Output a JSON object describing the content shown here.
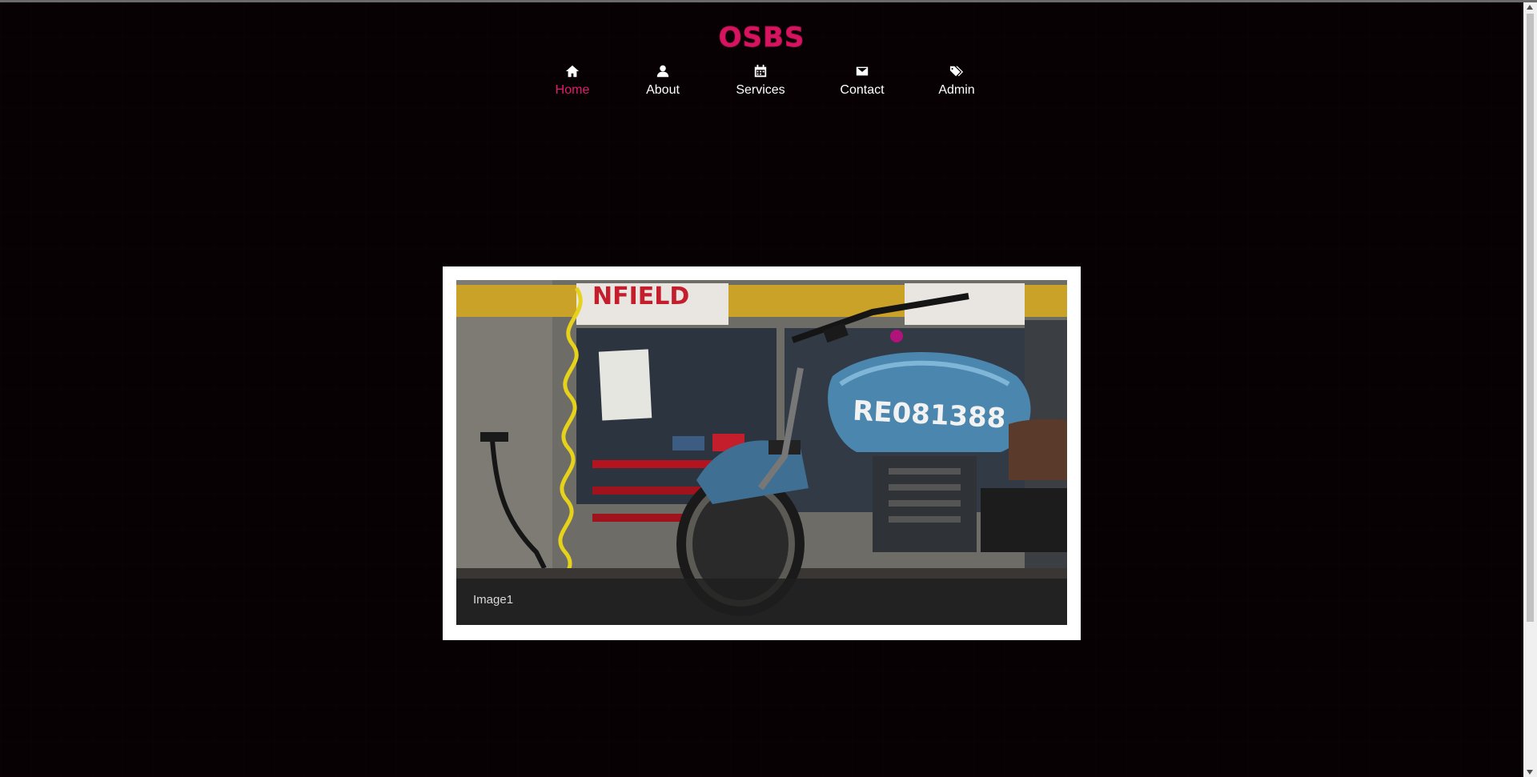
{
  "brand": {
    "logo": "OSBS",
    "accent_color": "#e31b6d"
  },
  "nav": {
    "items": [
      {
        "label": "Home",
        "icon": "home-icon",
        "active": true
      },
      {
        "label": "About",
        "icon": "user-icon",
        "active": false
      },
      {
        "label": "Services",
        "icon": "calendar-icon",
        "active": false
      },
      {
        "label": "Contact",
        "icon": "envelope-icon",
        "active": false
      },
      {
        "label": "Admin",
        "icon": "tags-icon",
        "active": false
      }
    ]
  },
  "slideshow": {
    "caption": "Image1",
    "plate_text": "RE081388",
    "sign_text": "NFIELD"
  }
}
